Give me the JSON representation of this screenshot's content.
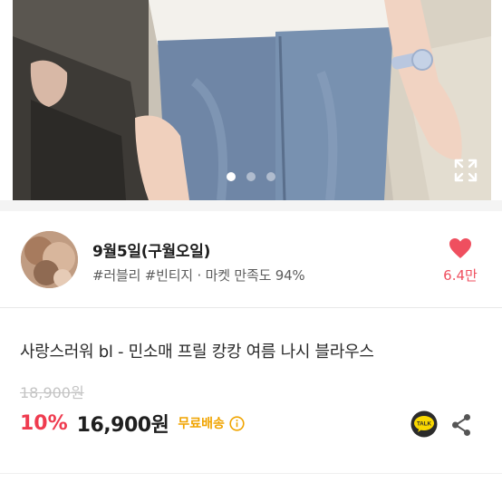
{
  "gallery": {
    "page_count": 3,
    "active_index": 0,
    "expand_icon": "expand-icon"
  },
  "shop": {
    "name": "9월5일(구월오일)",
    "meta": "#러블리 #빈티지 · 마켓 만족도 94%",
    "like_count": "6.4만",
    "like_icon": "heart-icon"
  },
  "product": {
    "title": "사랑스러워 bl - 민소매 프릴 캉캉 여름 나시 블라우스",
    "original_price": "18,900원",
    "discount": "10%",
    "price": "16,900원",
    "shipping": "무료배송"
  },
  "actions": {
    "talk_label": "TALK",
    "share_icon": "share-icon"
  },
  "colors": {
    "accent_red": "#ef3b4f",
    "heart": "#ef4f5f",
    "shipping": "#f0a400",
    "talk_bg": "#2b2b2b",
    "talk_bubble": "#f9d800"
  }
}
